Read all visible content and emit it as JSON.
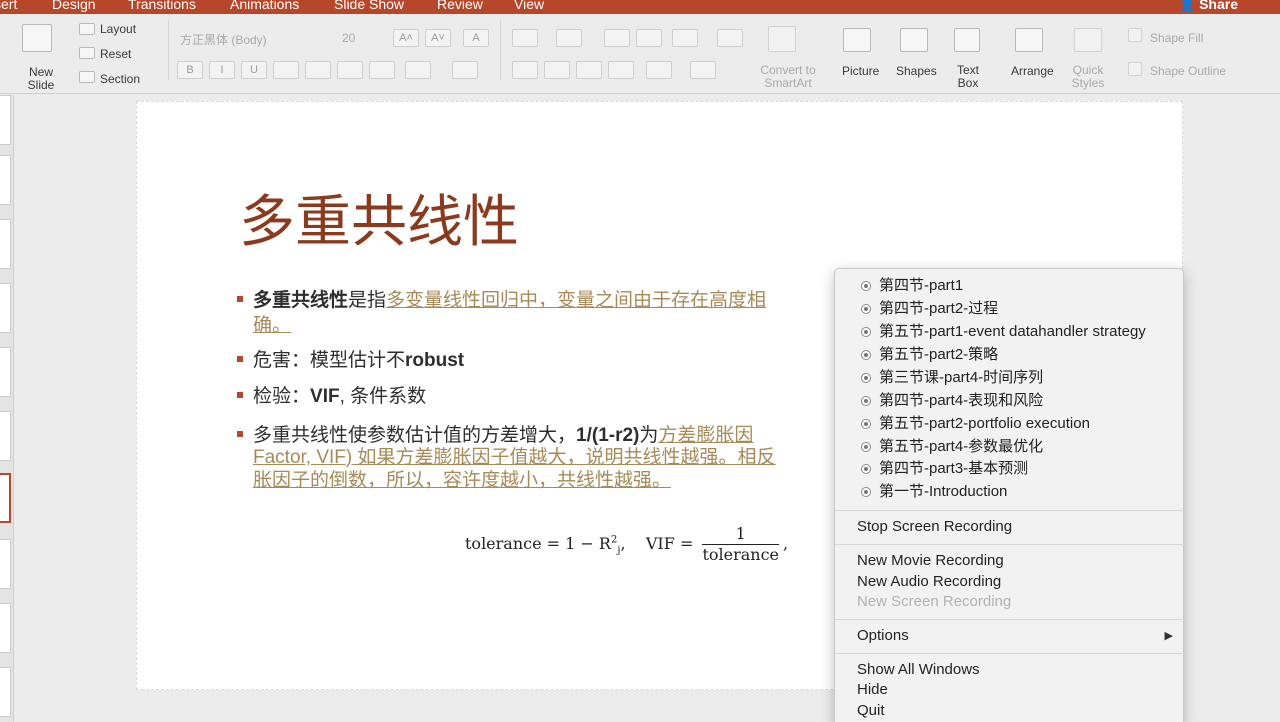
{
  "tabs": [
    "sert",
    "Design",
    "Transitions",
    "Animations",
    "Slide Show",
    "Review",
    "View"
  ],
  "share_label": "Share",
  "ribbon": {
    "new_slide": "New\nSlide",
    "layout": "Layout",
    "reset": "Reset",
    "section": "Section",
    "font_name": "方正黑体 (Body)",
    "font_size": "20",
    "convert_smartart": "Convert to\nSmartArt",
    "picture": "Picture",
    "shapes": "Shapes",
    "text_box": "Text\nBox",
    "arrange": "Arrange",
    "quick_styles": "Quick\nStyles",
    "shape_fill": "Shape Fill",
    "shape_outline": "Shape Outline",
    "fmt_bold": "B",
    "fmt_italic": "I",
    "fmt_underline": "U"
  },
  "slide": {
    "title": "多重共线性",
    "bullets": [
      {
        "bold": "多重共线性",
        "plain": "是指",
        "link": "多变量线性回归中，变量之间由于存在高度相"
      },
      {
        "plain": "危害：模型估计不",
        "bold": "robust"
      },
      {
        "plain": "检验：",
        "bold": "VIF",
        "plain2": ", 条件系数"
      },
      {
        "plain": "多重共线性使参数估计值的方差增大，",
        "bold": "1/(1-r2)",
        "plain2": "为",
        "link": "方差膨胀因"
      }
    ],
    "bullet1_cont": "确。",
    "bullet4_cont1": "Factor, VIF) 如果方差膨胀因子值越大，说明共线性越强。相反",
    "bullet4_cont2": "胀因子的倒数，所以，容许度越小，共线性越强。",
    "formula": {
      "tolerance_lhs": "tolerance = 1 − R",
      "r_sup": "2",
      "r_sub": "j",
      "vif_lhs": "VIF =",
      "num": "1",
      "den": "tolerance"
    }
  },
  "menu": {
    "windows": [
      "第四节-part1",
      "第四节-part2-过程",
      "第五节-part1-event datahandler strategy",
      "第五节-part2-策略",
      "第三节课-part4-时间序列",
      "第四节-part4-表现和风险",
      "第五节-part2-portfolio execution",
      "第五节-part4-参数最优化",
      "第四节-part3-基本预测",
      "第一节-Introduction"
    ],
    "stop_screen_recording": "Stop Screen Recording",
    "new_movie_recording": "New Movie Recording",
    "new_audio_recording": "New Audio Recording",
    "new_screen_recording": "New Screen Recording",
    "options": "Options",
    "show_all_windows": "Show All Windows",
    "hide": "Hide",
    "quit": "Quit"
  },
  "colors": {
    "accent": "#b7472a",
    "title": "#8b3a1e",
    "link": "#a88a58"
  }
}
